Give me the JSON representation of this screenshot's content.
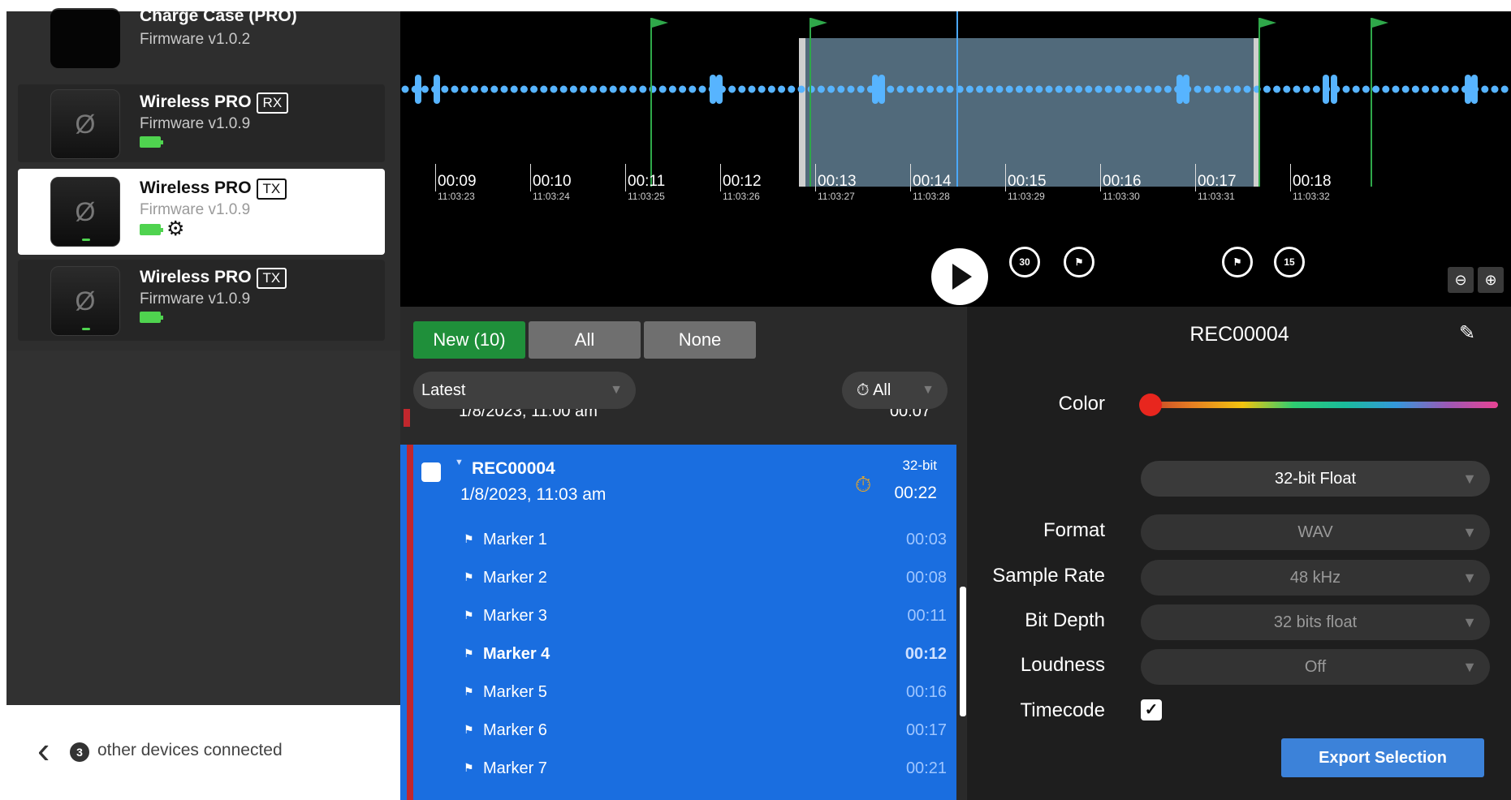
{
  "devices": [
    {
      "name": "Charge Case (PRO)",
      "badge": "",
      "firmware": "Firmware v1.0.2"
    },
    {
      "name": "Wireless PRO",
      "badge": "RX",
      "firmware": "Firmware v1.0.9"
    },
    {
      "name": "Wireless PRO",
      "badge": "TX",
      "firmware": "Firmware v1.0.9"
    },
    {
      "name": "Wireless PRO",
      "badge": "TX",
      "firmware": "Firmware v1.0.9"
    }
  ],
  "footer": {
    "count": "3",
    "text": "other devices connected"
  },
  "timeline": {
    "ticks": [
      {
        "t": "00:09",
        "s": "11:03:23"
      },
      {
        "t": "00:10",
        "s": "11:03:24"
      },
      {
        "t": "00:11",
        "s": "11:03:25"
      },
      {
        "t": "00:12",
        "s": "11:03:26"
      },
      {
        "t": "00:13",
        "s": "11:03:27"
      },
      {
        "t": "00:14",
        "s": "11:03:28"
      },
      {
        "t": "00:15",
        "s": "11:03:29"
      },
      {
        "t": "00:16",
        "s": "11:03:30"
      },
      {
        "t": "00:17",
        "s": "11:03:31"
      },
      {
        "t": "00:18",
        "s": "11:03:32"
      }
    ],
    "rewind15": "15",
    "forward30": "30"
  },
  "filters": {
    "new": "New (10)",
    "all": "All",
    "none": "None"
  },
  "sort": {
    "value": "Latest"
  },
  "type_filter": {
    "value": "All"
  },
  "prev_row": {
    "date": "1/8/2023, 11:00 am",
    "time": "00:07"
  },
  "recording": {
    "name": "REC00004",
    "date": "1/8/2023, 11:03 am",
    "bit": "32-bit",
    "duration": "00:22",
    "markers": [
      {
        "name": "Marker 1",
        "time": "00:03"
      },
      {
        "name": "Marker 2",
        "time": "00:08"
      },
      {
        "name": "Marker 3",
        "time": "00:11"
      },
      {
        "name": "Marker 4",
        "time": "00:12"
      },
      {
        "name": "Marker 5",
        "time": "00:16"
      },
      {
        "name": "Marker 6",
        "time": "00:17"
      },
      {
        "name": "Marker 7",
        "time": "00:21"
      }
    ]
  },
  "settings": {
    "title": "REC00004",
    "color_label": "Color",
    "preset": "32-bit Float",
    "format_label": "Format",
    "format": "WAV",
    "rate_label": "Sample Rate",
    "rate": "48 kHz",
    "depth_label": "Bit Depth",
    "depth": "32 bits float",
    "loudness_label": "Loudness",
    "loudness": "Off",
    "timecode_label": "Timecode",
    "export": "Export Selection"
  },
  "colors": {
    "accent_blue": "#1a6ee0",
    "new_green": "#1f8f3a",
    "marker_green": "#2fa84a",
    "rec_red": "#c1272d",
    "wave_blue": "#57b4ff"
  },
  "icons": [
    "settings-gear-icon",
    "chevron-left-icon",
    "prev-marker-icon",
    "rewind-15-icon",
    "play-icon",
    "forward-30-icon",
    "next-marker-icon",
    "zoom-out-icon",
    "zoom-in-icon",
    "timer-icon",
    "edit-icon",
    "marker-flag-icon",
    "dropdown-arrow-icon"
  ]
}
